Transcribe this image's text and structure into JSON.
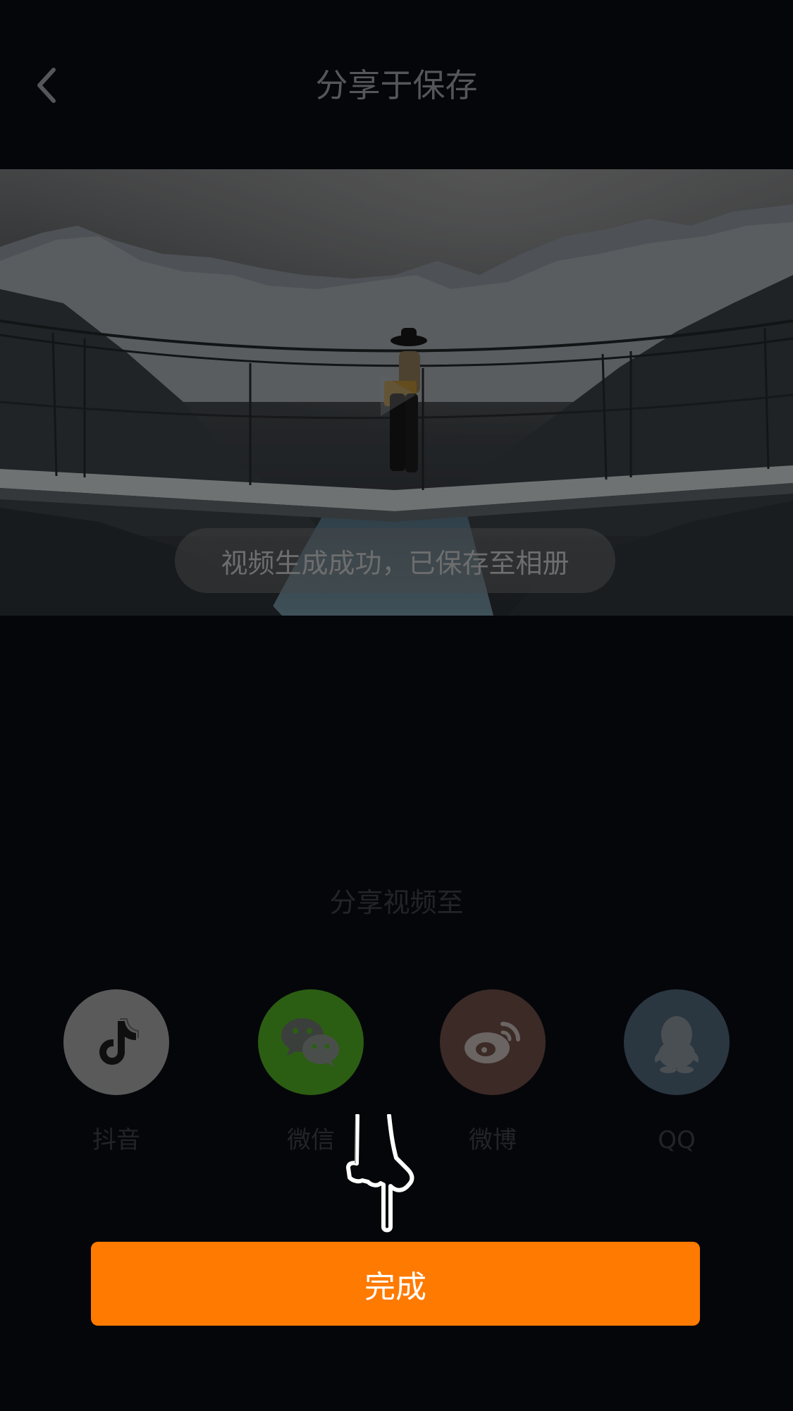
{
  "header": {
    "title": "分享于保存",
    "back_icon": "chevron-left-icon"
  },
  "preview": {
    "toast": "视频生成成功，已保存至相册"
  },
  "share": {
    "title": "分享视频至",
    "items": [
      {
        "label": "抖音",
        "icon": "douyin-icon",
        "color": "#5a5a5a"
      },
      {
        "label": "微信",
        "icon": "wechat-icon",
        "color": "#2b5e13"
      },
      {
        "label": "微博",
        "icon": "weibo-icon",
        "color": "#3b2a26"
      },
      {
        "label": "QQ",
        "icon": "qq-icon",
        "color": "#2a3640"
      }
    ]
  },
  "done_button": {
    "label": "完成",
    "color": "#ff7a00"
  }
}
